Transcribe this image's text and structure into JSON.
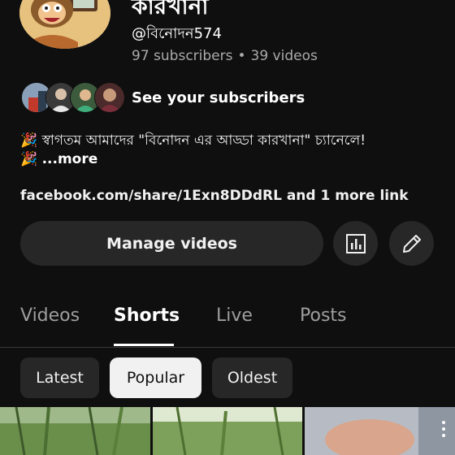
{
  "channel": {
    "name": "কারখানা",
    "handle": "@বিনোদন574",
    "subscribers": "97 subscribers",
    "separator": "•",
    "videos": "39 videos"
  },
  "subscribers_link": {
    "label": "See your subscribers"
  },
  "description": {
    "line1": "🎉 স্বাগতম আমাদের \"বিনোদন এর আড্ডা কারখানা\" চ্যানেলে!",
    "line2_emoji": "🎉",
    "more": "...more"
  },
  "links": {
    "text": "facebook.com/share/1Exn8DDdRL and 1 more link"
  },
  "actions": {
    "manage_videos": "Manage videos",
    "analytics_icon": "analytics-icon",
    "edit_icon": "pencil-icon"
  },
  "tabs": [
    {
      "label": "Videos",
      "active": false
    },
    {
      "label": "Shorts",
      "active": true
    },
    {
      "label": "Live",
      "active": false
    },
    {
      "label": "Posts",
      "active": false
    }
  ],
  "chips": [
    {
      "label": "Latest",
      "selected": false
    },
    {
      "label": "Popular",
      "selected": true
    },
    {
      "label": "Oldest",
      "selected": false
    }
  ],
  "colors": {
    "background": "#0f0f0f",
    "surface": "#272727",
    "text": "#f1f1f1",
    "muted": "#aaaaaa"
  }
}
